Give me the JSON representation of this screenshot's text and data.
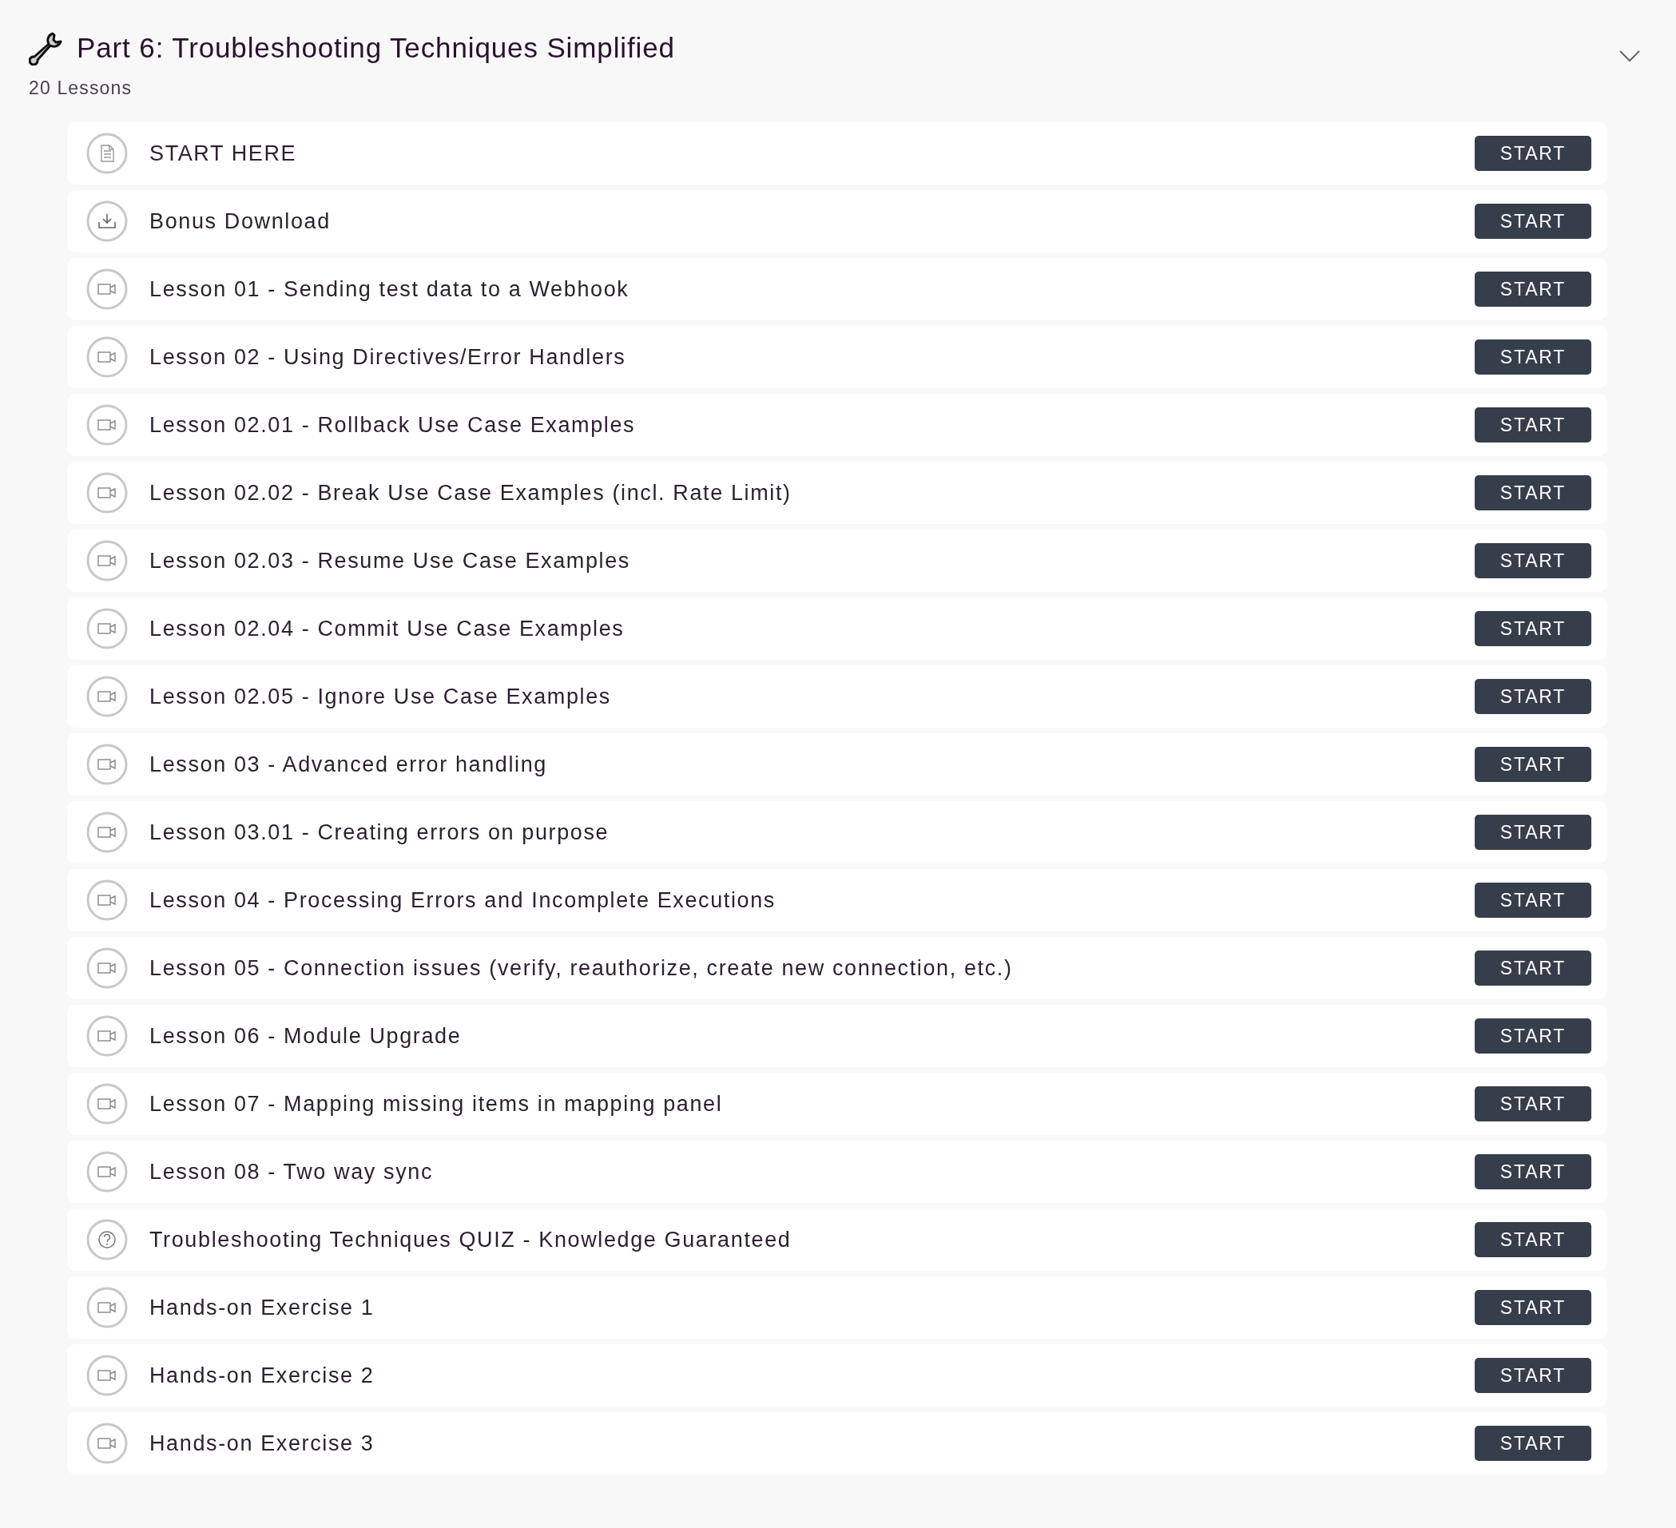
{
  "section": {
    "title": "Part 6: Troubleshooting Techniques Simplified",
    "subtitle": "20 Lessons",
    "expanded": true
  },
  "lessons": [
    {
      "kind": "document",
      "title": "START HERE",
      "button": "START"
    },
    {
      "kind": "download",
      "title": "Bonus Download",
      "button": "START"
    },
    {
      "kind": "video",
      "title": "Lesson 01 - Sending test data to a Webhook",
      "button": "START"
    },
    {
      "kind": "video",
      "title": "Lesson 02 - Using Directives/Error Handlers",
      "button": "START"
    },
    {
      "kind": "video",
      "title": "Lesson 02.01 - Rollback Use Case Examples",
      "button": "START"
    },
    {
      "kind": "video",
      "title": "Lesson 02.02 - Break Use Case Examples (incl. Rate Limit)",
      "button": "START"
    },
    {
      "kind": "video",
      "title": "Lesson 02.03 - Resume Use Case Examples",
      "button": "START"
    },
    {
      "kind": "video",
      "title": "Lesson 02.04 - Commit Use Case Examples",
      "button": "START"
    },
    {
      "kind": "video",
      "title": "Lesson 02.05 - Ignore Use Case Examples",
      "button": "START"
    },
    {
      "kind": "video",
      "title": "Lesson 03 - Advanced error handling",
      "button": "START"
    },
    {
      "kind": "video",
      "title": "Lesson 03.01 - Creating errors on purpose",
      "button": "START"
    },
    {
      "kind": "video",
      "title": "Lesson 04 - Processing Errors and Incomplete Executions",
      "button": "START"
    },
    {
      "kind": "video",
      "title": "Lesson 05 - Connection issues (verify, reauthorize, create new connection, etc.)",
      "button": "START"
    },
    {
      "kind": "video",
      "title": "Lesson 06 - Module Upgrade",
      "button": "START"
    },
    {
      "kind": "video",
      "title": "Lesson 07 - Mapping missing items in mapping panel",
      "button": "START"
    },
    {
      "kind": "video",
      "title": "Lesson 08 - Two way sync",
      "button": "START"
    },
    {
      "kind": "quiz",
      "title": "Troubleshooting Techniques QUIZ - Knowledge Guaranteed",
      "button": "START"
    },
    {
      "kind": "video",
      "title": "Hands-on Exercise 1",
      "button": "START"
    },
    {
      "kind": "video",
      "title": "Hands-on Exercise 2",
      "button": "START"
    },
    {
      "kind": "video",
      "title": "Hands-on Exercise 3",
      "button": "START"
    }
  ]
}
